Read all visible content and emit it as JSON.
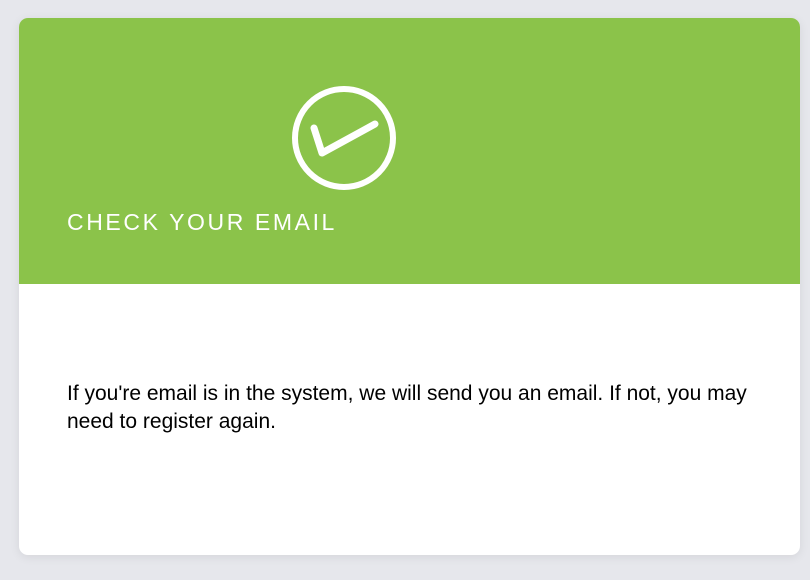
{
  "card": {
    "title": "CHECK YOUR EMAIL",
    "message": "If you're email is in the system, we will send you an email. If not, you may need to register again.",
    "icon": "check-circle-icon"
  },
  "colors": {
    "header_bg": "#8bc34a",
    "card_bg": "#ffffff",
    "page_bg": "#e6e7ec",
    "title_text": "#ffffff",
    "body_text": "#000000"
  }
}
